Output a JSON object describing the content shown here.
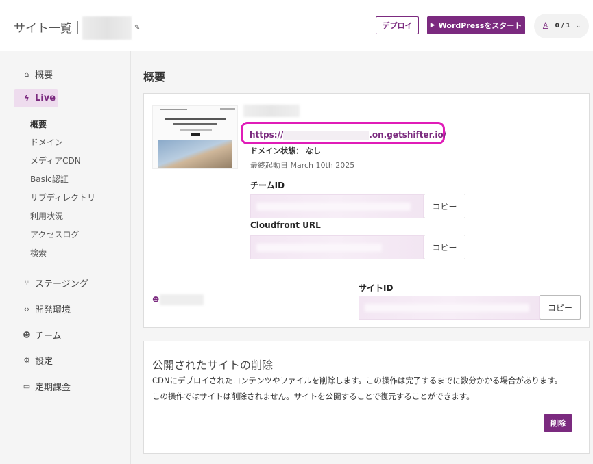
{
  "header": {
    "title": "サイト一覧",
    "edit_icon": "✎",
    "deploy_label": "デプロイ",
    "start_label": "WordPressをスタート",
    "user_count": "0 / 1"
  },
  "sidebar": {
    "overview": "概要",
    "live": "Live",
    "live_items": [
      "概要",
      "ドメイン",
      "メディアCDN",
      "Basic認証",
      "サブディレクトリ",
      "利用状況",
      "アクセスログ",
      "検索"
    ],
    "staging": "ステージング",
    "dev_env": "開発環境",
    "team": "チーム",
    "settings": "設定",
    "billing": "定期課金"
  },
  "main": {
    "title": "概要",
    "site": {
      "url_prefix": "https://",
      "url_suffix": ".on.getshifter.io/",
      "domain_state": "ドメイン状態： なし",
      "last_boot": "最終起動日 March 10th 2025"
    },
    "team_id_label": "チームID",
    "cloudfront_label": "Cloudfront URL",
    "site_id_label": "サイトID",
    "copy_label": "コピー"
  },
  "delete_section": {
    "title": "公開されたサイトの削除",
    "line1": "CDNにデプロイされたコンテンツやファイルを削除します。この操作は完了するまでに数分かかる場合があります。",
    "line2": "この操作ではサイトは削除されません。サイトを公開することで復元することができます。",
    "button": "削除"
  },
  "colors": {
    "brand": "#7b2a7f",
    "highlight": "#e01cb8"
  }
}
